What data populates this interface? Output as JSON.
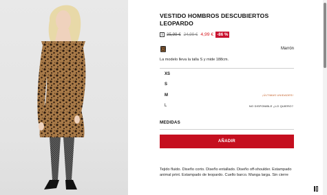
{
  "product": {
    "title": "VESTIDO HOMBROS DESCUBIERTOS LEOPARDO",
    "price_original": "35,99 €",
    "price_previous": "24,99 €",
    "price_current": "4,99 €",
    "discount": "-86 %",
    "color_name": "Marrón",
    "model_info": "La modelo lleva la talla S y mide 188cm."
  },
  "sizes": [
    {
      "label": "XS",
      "note": ""
    },
    {
      "label": "S",
      "note": ""
    },
    {
      "label": "M",
      "note": "¡ÚLTIMAS UNIDADES!"
    },
    {
      "label": "L",
      "note": "NO DISPONIBLE ¿LO QUIERO?"
    }
  ],
  "measures_label": "MEDIDAS",
  "add_button_label": "AÑADIR",
  "description": "Tejido fluido. Diseño corto. Diseño entallado. Diseño off-shoulder. Estampado animal print. Estampado de leopardo. Cuello barco. Manga larga. Sin cierre",
  "colors": {
    "accent": "#c50f1f",
    "discount_bg": "#c8102e",
    "warning": "#c25a1f"
  },
  "icons": {
    "info": "info-square-icon",
    "swatch": "leopard-swatch-icon",
    "view": "grid-view-icon"
  }
}
